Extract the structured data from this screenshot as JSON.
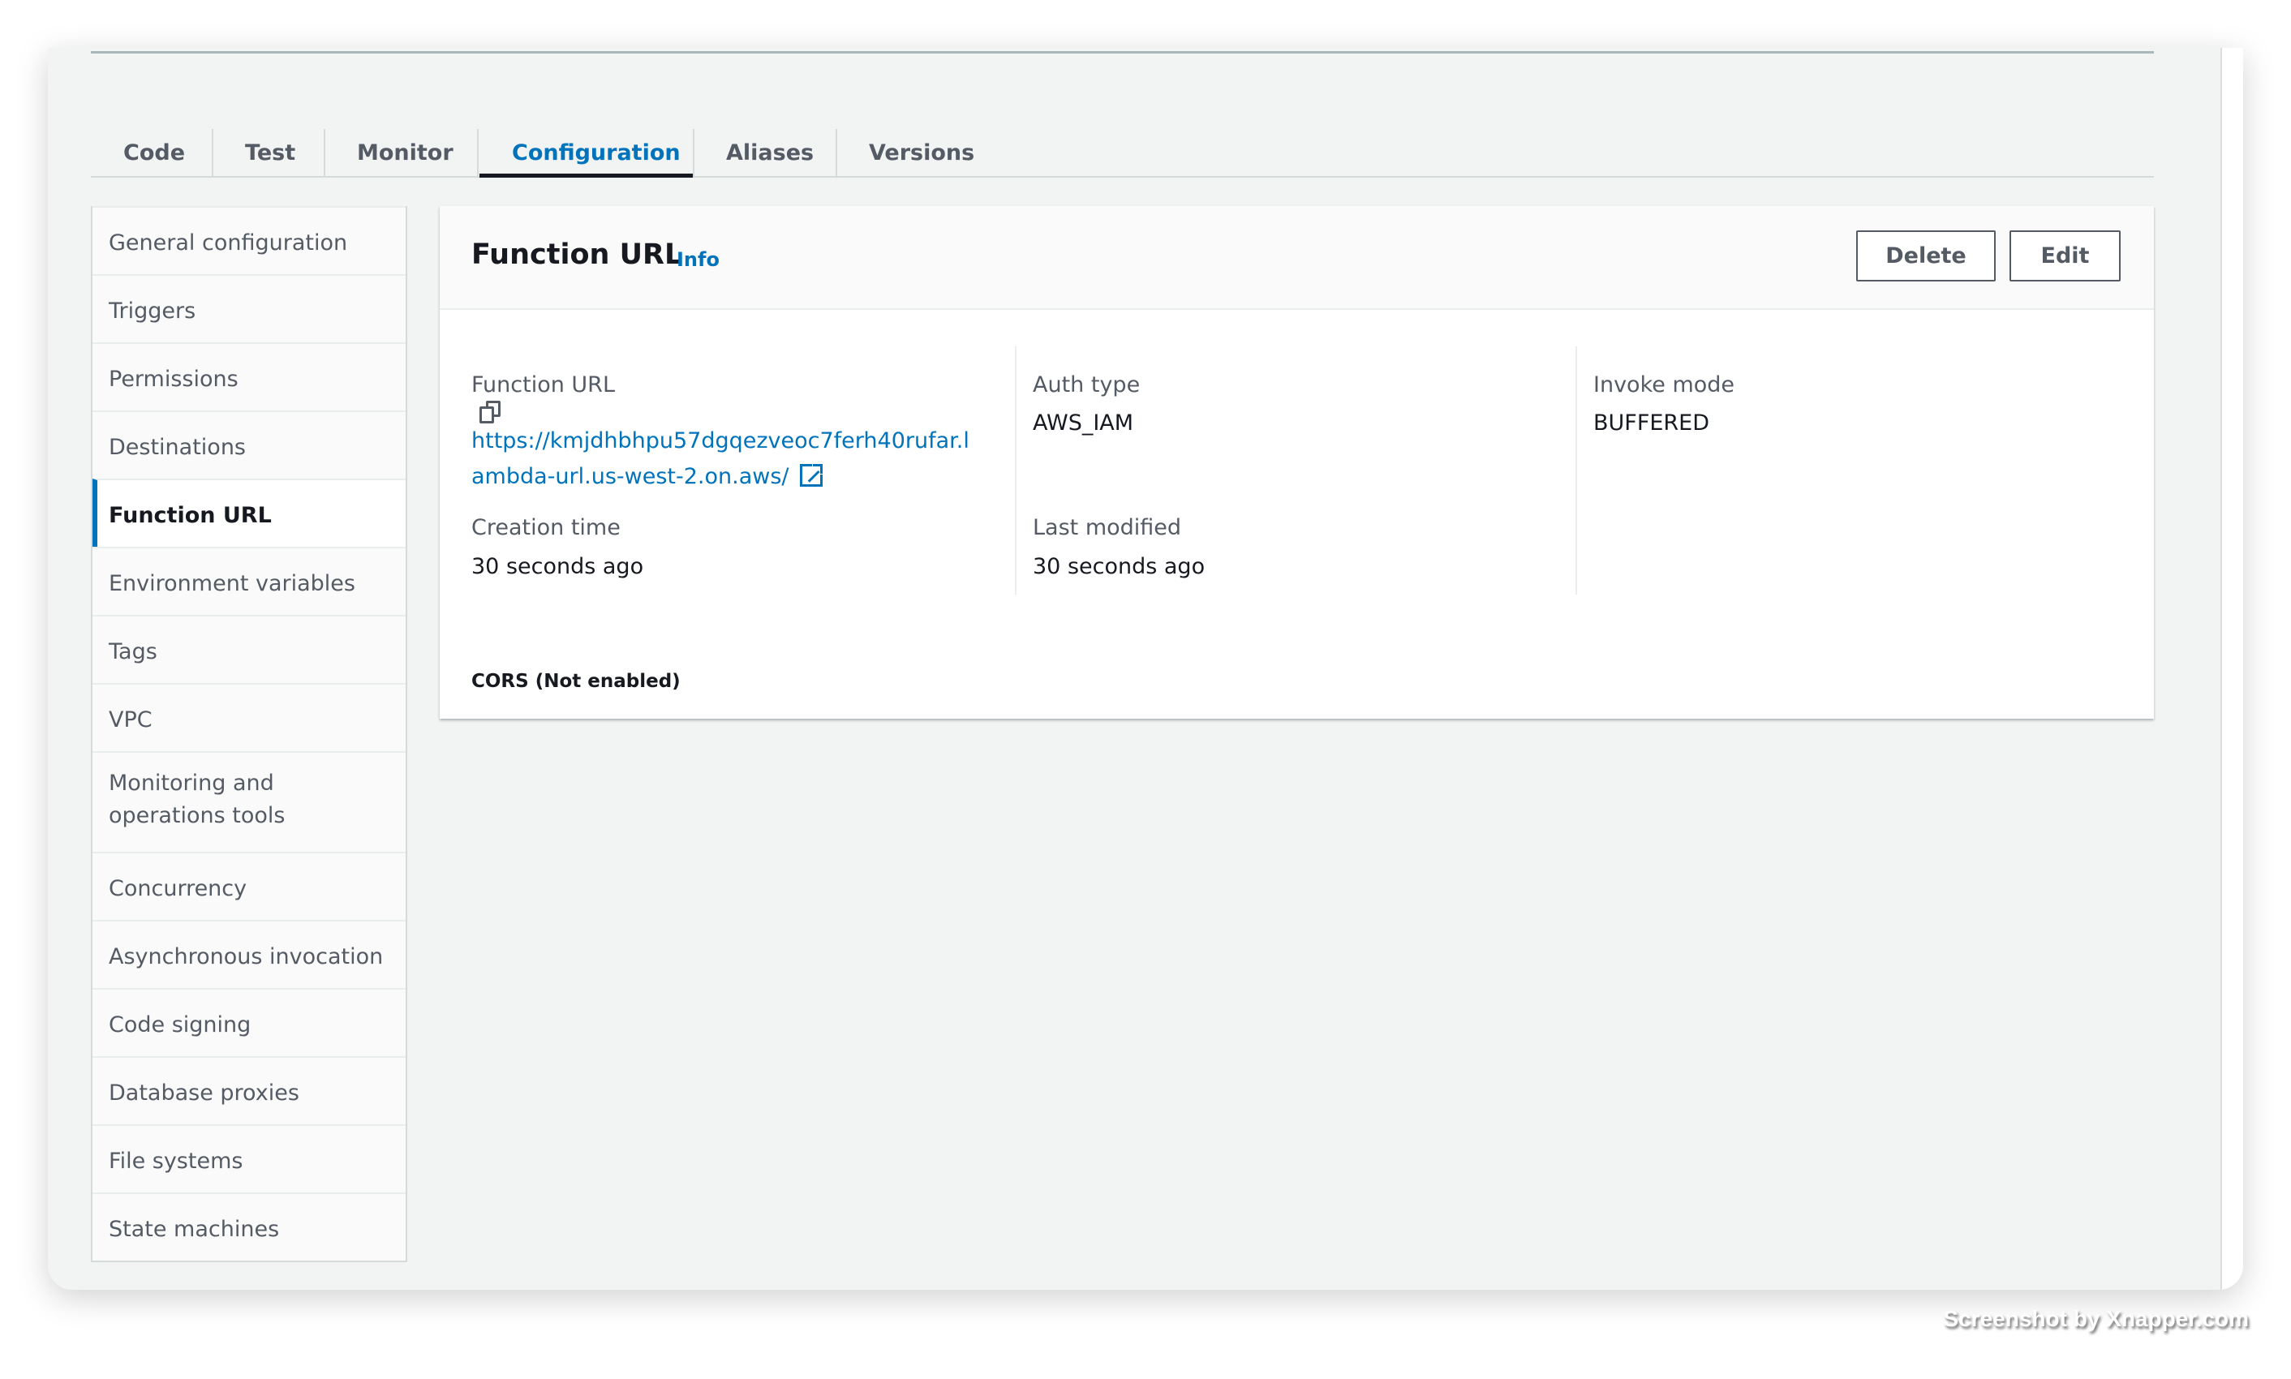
{
  "tabs": [
    "Code",
    "Test",
    "Monitor",
    "Configuration",
    "Aliases",
    "Versions"
  ],
  "active_tab": "Configuration",
  "sidebar": {
    "items": [
      "General configuration",
      "Triggers",
      "Permissions",
      "Destinations",
      "Function URL",
      "Environment variables",
      "Tags",
      "VPC",
      "Monitoring and operations tools",
      "Concurrency",
      "Asynchronous invocation",
      "Code signing",
      "Database proxies",
      "File systems",
      "State machines"
    ],
    "active": "Function URL"
  },
  "panel": {
    "title": "Function URL",
    "info": "Info",
    "delete": "Delete",
    "edit": "Edit",
    "function_url_label": "Function URL",
    "function_url_line1": "https://kmjdhbhpu57dgqezveoc7ferh40rufar.l",
    "function_url_line2": "ambda-url.us-west-2.on.aws/",
    "auth_type_label": "Auth type",
    "auth_type": "AWS_IAM",
    "invoke_mode_label": "Invoke mode",
    "invoke_mode": "BUFFERED",
    "creation_time_label": "Creation time",
    "creation_time": "30 seconds ago",
    "last_modified_label": "Last modified",
    "last_modified": "30 seconds ago",
    "cors": "CORS (Not enabled)"
  },
  "icons": {
    "copy": "copy-icon",
    "external": "external-link-icon"
  },
  "colors": {
    "accent": "#0073bb",
    "background": "#f2f3f3"
  },
  "watermark": "Screenshot by Xnapper.com"
}
